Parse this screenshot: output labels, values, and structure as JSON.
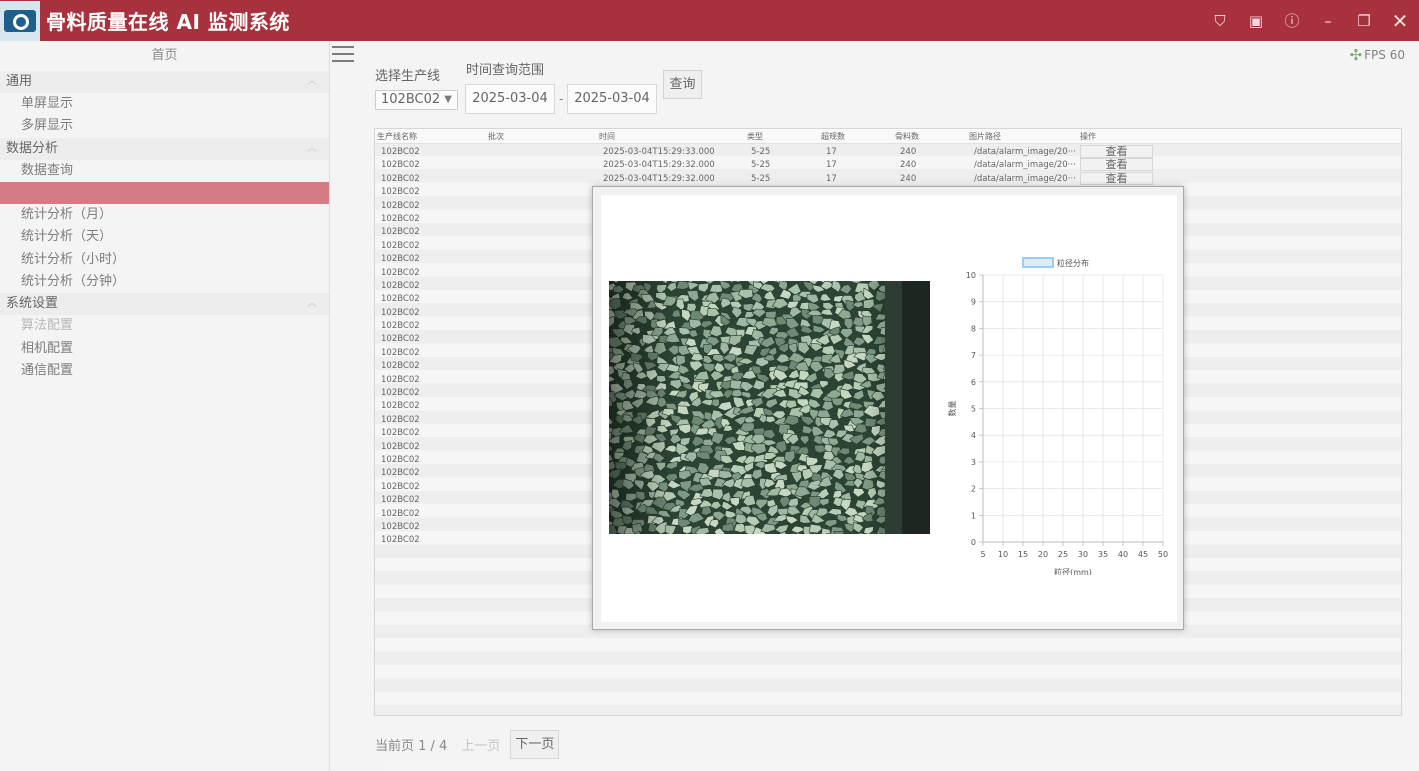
{
  "app": {
    "title": "骨料质量在线 AI 监测系统",
    "window_controls": [
      "shirt-icon",
      "window-icon",
      "info-icon",
      "minimize-icon",
      "restore-icon",
      "close-icon"
    ]
  },
  "sidebar": {
    "home": "首页",
    "sections": [
      {
        "title": "通用",
        "items": [
          {
            "label": "单屏显示"
          },
          {
            "label": "多屏显示"
          }
        ]
      },
      {
        "title": "数据分析",
        "items": [
          {
            "label": "数据查询"
          },
          {
            "label": ""
          },
          {
            "label": "统计分析（月）"
          },
          {
            "label": "统计分析（天）"
          },
          {
            "label": "统计分析（小时）"
          },
          {
            "label": "统计分析（分钟）"
          }
        ]
      },
      {
        "title": "系统设置",
        "items": [
          {
            "label": "算法配置"
          },
          {
            "label": "相机配置"
          },
          {
            "label": "通信配置"
          }
        ]
      }
    ]
  },
  "header": {
    "fps": "FPS 60"
  },
  "query": {
    "line_label": "选择生产线",
    "time_label": "时间查询范围",
    "line_value": "102BC02",
    "start_date": "2025-03-04",
    "separator": "-",
    "end_date": "2025-03-04",
    "query_button": "查询"
  },
  "table": {
    "columns": [
      "生产线名称",
      "批次",
      "时间",
      "类型",
      "超规数",
      "骨料数",
      "图片路径",
      "操作"
    ],
    "rows": [
      {
        "line": "102BC02",
        "batch": "",
        "time": "2025-03-04T15:29:33.000",
        "type": "5-25",
        "over": "17",
        "count": "240",
        "path": "/data/alarm_image/20···",
        "action": "查看"
      },
      {
        "line": "102BC02",
        "batch": "",
        "time": "2025-03-04T15:29:32.000",
        "type": "5-25",
        "over": "17",
        "count": "240",
        "path": "/data/alarm_image/20···",
        "action": "查看"
      },
      {
        "line": "102BC02",
        "batch": "",
        "time": "2025-03-04T15:29:32.000",
        "type": "5-25",
        "over": "17",
        "count": "240",
        "path": "/data/alarm_image/20···",
        "action": "查看"
      },
      {
        "line": "102BC02"
      },
      {
        "line": "102BC02"
      },
      {
        "line": "102BC02"
      },
      {
        "line": "102BC02"
      },
      {
        "line": "102BC02"
      },
      {
        "line": "102BC02"
      },
      {
        "line": "102BC02"
      },
      {
        "line": "102BC02"
      },
      {
        "line": "102BC02"
      },
      {
        "line": "102BC02"
      },
      {
        "line": "102BC02"
      },
      {
        "line": "102BC02"
      },
      {
        "line": "102BC02"
      },
      {
        "line": "102BC02"
      },
      {
        "line": "102BC02"
      },
      {
        "line": "102BC02"
      },
      {
        "line": "102BC02"
      },
      {
        "line": "102BC02"
      },
      {
        "line": "102BC02"
      },
      {
        "line": "102BC02"
      },
      {
        "line": "102BC02"
      },
      {
        "line": "102BC02"
      },
      {
        "line": "102BC02"
      },
      {
        "line": "102BC02"
      },
      {
        "line": "102BC02"
      },
      {
        "line": "102BC02"
      },
      {
        "line": "102BC02"
      }
    ]
  },
  "pager": {
    "info": "当前页 1 / 4",
    "prev": "上一页",
    "next": "下一页"
  },
  "chart_data": {
    "type": "bar",
    "legend": "粒径分布",
    "xlabel": "粒径(mm)",
    "ylabel": "数量",
    "x": [
      5,
      10,
      15,
      20,
      25,
      30,
      35,
      40,
      45,
      50
    ],
    "ylim": [
      0,
      10
    ],
    "yticks": [
      0,
      1,
      2,
      3,
      4,
      5,
      6,
      7,
      8,
      9,
      10
    ],
    "series": [
      {
        "name": "粒径分布",
        "values": []
      }
    ],
    "grid": true,
    "legend_position": "top",
    "color": "#9fcdf0"
  }
}
